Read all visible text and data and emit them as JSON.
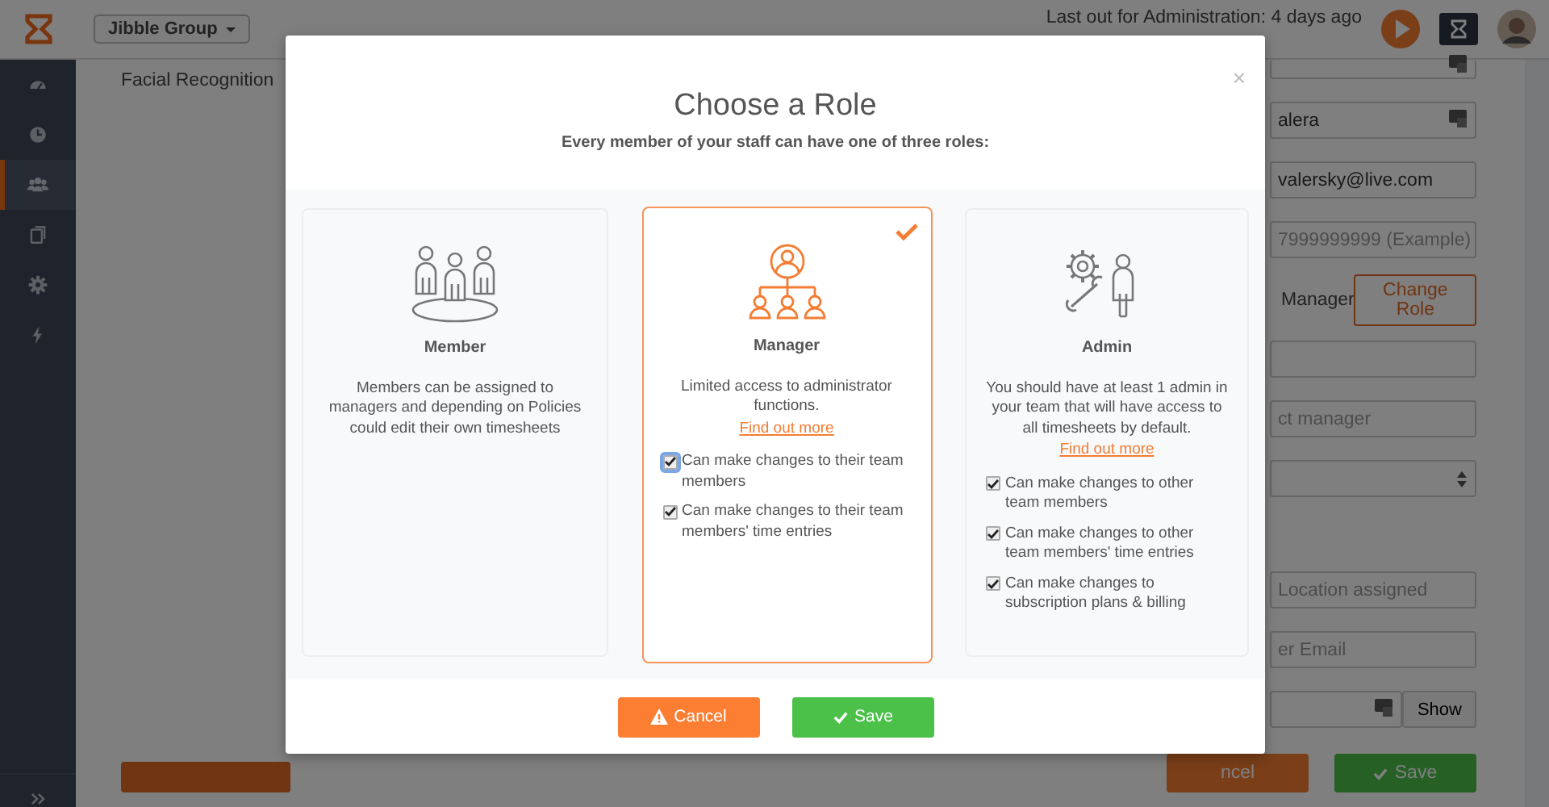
{
  "topbar": {
    "workspace": "Jibble Group",
    "status": "Last out for Administration: 4 days ago"
  },
  "sidebar": {
    "items": [
      {
        "selected": false
      },
      {
        "selected": false
      },
      {
        "selected": true
      },
      {
        "selected": false
      },
      {
        "selected": false
      },
      {
        "selected": false
      }
    ]
  },
  "page": {
    "section_label": "Facial Recognition",
    "fields": [
      {
        "kind": "input",
        "has_icon": true
      },
      {
        "kind": "input",
        "value": "alera",
        "has_icon": true
      },
      {
        "kind": "input",
        "value": "valersky@live.com"
      },
      {
        "kind": "input",
        "placeholder": "7999999999 (Example)"
      },
      {
        "kind": "role",
        "value": "Manager",
        "button": "Change Role"
      },
      {
        "kind": "input"
      },
      {
        "kind": "input",
        "placeholder": "ct manager"
      },
      {
        "kind": "select"
      },
      {
        "kind": "input",
        "placeholder": "Location assigned"
      },
      {
        "kind": "input",
        "placeholder": "er Email"
      },
      {
        "kind": "password",
        "has_icon": true,
        "button": "Show"
      }
    ],
    "buttons": [
      {
        "kind": "danger"
      },
      {
        "kind": "cancel",
        "label": "ncel"
      },
      {
        "kind": "save",
        "label": "Save"
      }
    ]
  },
  "dialog": {
    "title": "Choose a Role",
    "subtitle": "Every member of your staff can have one of three roles:",
    "close": "×",
    "roles": [
      {
        "kind": "member",
        "name": "Member",
        "selected": false,
        "description": "Members can be assigned to managers and depending on Policies could edit their own timesheets"
      },
      {
        "kind": "manager",
        "name": "Manager",
        "selected": true,
        "description": "Limited access to administrator functions.",
        "link": "Find out more",
        "permissions": [
          {
            "text": "Can make changes to their team members",
            "checked": true,
            "focused": true
          },
          {
            "text": "Can make changes to their team members' time entries",
            "checked": true,
            "focused": false
          }
        ]
      },
      {
        "kind": "admin",
        "name": "Admin",
        "selected": false,
        "description": "You should have at least 1 admin in your team that will have access to all timesheets by default.",
        "link": "Find out more",
        "permissions": [
          {
            "text": "Can make changes to other team members",
            "checked": true,
            "focused": false
          },
          {
            "text": "Can make changes to other team members' time entries",
            "checked": true,
            "focused": false
          },
          {
            "text": "Can make changes to subscription plans & billing",
            "checked": true,
            "focused": false
          }
        ]
      }
    ],
    "buttons": [
      {
        "kind": "cancel",
        "label": "Cancel"
      },
      {
        "kind": "save",
        "label": "Save"
      }
    ]
  }
}
